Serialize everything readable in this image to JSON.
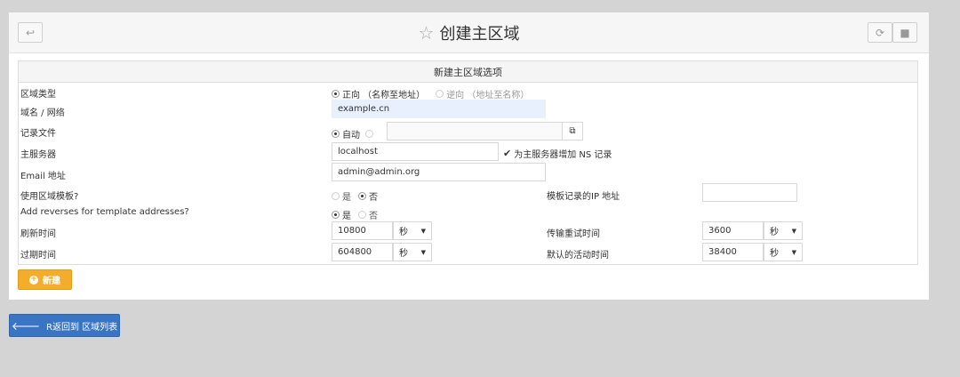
{
  "header": {
    "back_icon": "back-arrow-icon",
    "star_icon": "star-outline-icon",
    "title": "创建主区域",
    "refresh_icon": "refresh-icon",
    "stop_icon": "stop-icon"
  },
  "form": {
    "section_title": "新建主区域选项",
    "zone_type": {
      "label": "区域类型",
      "forward": "正向 （名称至地址）",
      "reverse": "逆向 （地址至名称）",
      "selected": "forward"
    },
    "domain": {
      "label": "域名 / 网络",
      "value": "example.cn"
    },
    "records_file": {
      "label": "记录文件",
      "auto": "自动",
      "value": ""
    },
    "master_server": {
      "label": "主服务器",
      "value": "localhost",
      "ns_checkbox": "为主服务器增加 NS 记录",
      "checked": true
    },
    "email": {
      "label": "Email 地址",
      "value": "admin@admin.org"
    },
    "use_template": {
      "label": "使用区域模板?",
      "yes": "是",
      "no": "否",
      "selected": "no"
    },
    "template_ip": {
      "label": "模板记录的IP 地址",
      "value": ""
    },
    "add_reverses": {
      "label": "Add reverses for template addresses?",
      "yes": "是",
      "no": "否",
      "selected": "yes"
    },
    "refresh": {
      "label": "刷新时间",
      "value": "10800",
      "unit": "秒"
    },
    "retry": {
      "label": "传输重试时间",
      "value": "3600",
      "unit": "秒"
    },
    "expire": {
      "label": "过期时间",
      "value": "604800",
      "unit": "秒"
    },
    "default_ttl": {
      "label": "默认的活动时间",
      "value": "38400",
      "unit": "秒"
    }
  },
  "buttons": {
    "create": "新建",
    "back": "R返回到 区域列表"
  }
}
